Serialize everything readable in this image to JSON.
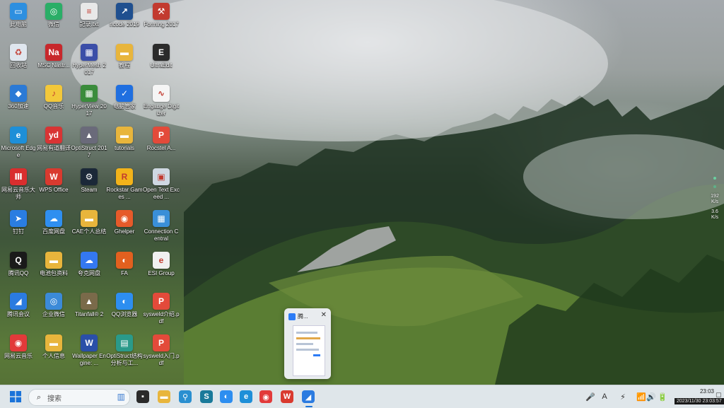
{
  "desktop": {
    "icons": [
      {
        "label": "此电脑",
        "glyph": "▭",
        "color": "#2d8fe0"
      },
      {
        "label": "微信",
        "glyph": "◎",
        "color": "#2aae67"
      },
      {
        "label": "記录.txt",
        "glyph": "≡",
        "color": "#e8e8e8"
      },
      {
        "label": "ncode 2019",
        "glyph": "↗",
        "color": "#1f4f8f"
      },
      {
        "label": "Forming 2017",
        "glyph": "⚒",
        "color": "#c23a2f"
      },
      {
        "label": "回收站",
        "glyph": "♻",
        "color": "#dfe6ee"
      },
      {
        "label": "MSC Nastr...",
        "glyph": "Na",
        "color": "#c8282c"
      },
      {
        "label": "HyperMesh 2017",
        "glyph": "▦",
        "color": "#3b4ea8"
      },
      {
        "label": "教程",
        "glyph": "▬",
        "color": "#e8b53c"
      },
      {
        "label": "UltraEdit",
        "glyph": "E",
        "color": "#2b2b2b"
      },
      {
        "label": "360加速",
        "glyph": "◆",
        "color": "#2b7ad6"
      },
      {
        "label": "QQ音乐",
        "glyph": "♪",
        "color": "#f3c83a"
      },
      {
        "label": "HyperView 2017",
        "glyph": "▦",
        "color": "#3b8c3c"
      },
      {
        "label": "电脑管家",
        "glyph": "✓",
        "color": "#1f6fe0"
      },
      {
        "label": "Engauge Digitizer",
        "glyph": "∿",
        "color": "#f5f5f5"
      },
      {
        "label": "Microsoft Edge",
        "glyph": "e",
        "color": "#1e8fd8"
      },
      {
        "label": "网易有道翻译",
        "glyph": "yd",
        "color": "#d83434"
      },
      {
        "label": "OptiStruct 2017",
        "glyph": "▲",
        "color": "#6a6a7a"
      },
      {
        "label": "tutorials",
        "glyph": "▬",
        "color": "#e8b53c"
      },
      {
        "label": "Rocstel A...",
        "glyph": "P",
        "color": "#e34a3a"
      },
      {
        "label": "网易云音乐大师",
        "glyph": "Ⅲ",
        "color": "#d92e2e"
      },
      {
        "label": "WPS Office",
        "glyph": "W",
        "color": "#d93a2f"
      },
      {
        "label": "Steam",
        "glyph": "⚙",
        "color": "#1b2838"
      },
      {
        "label": "Rockstar Games ...",
        "glyph": "R",
        "color": "#f2b31a"
      },
      {
        "label": "Open Text Exceed ...",
        "glyph": "▣",
        "color": "#cfd8e2"
      },
      {
        "label": "钉钉",
        "glyph": "➤",
        "color": "#2a7de1"
      },
      {
        "label": "百度网盘",
        "glyph": "☁",
        "color": "#2f8ff0"
      },
      {
        "label": "CAE个人总结",
        "glyph": "▬",
        "color": "#e8b53c"
      },
      {
        "label": "Ghelper",
        "glyph": "◉",
        "color": "#e65a2a"
      },
      {
        "label": "Connection Central",
        "glyph": "▦",
        "color": "#3a8fd8"
      },
      {
        "label": "腾讯QQ",
        "glyph": "Q",
        "color": "#1a1a1a"
      },
      {
        "label": "电池包资料",
        "glyph": "▬",
        "color": "#e8b53c"
      },
      {
        "label": "夸克网盘",
        "glyph": "☁",
        "color": "#3478f0"
      },
      {
        "label": "FA",
        "glyph": "◐",
        "color": "#e2601f"
      },
      {
        "label": "ESI Group",
        "glyph": "e",
        "color": "#f0f0f0"
      },
      {
        "label": "腾讯会议",
        "glyph": "◢",
        "color": "#2b7be0"
      },
      {
        "label": "企业微信",
        "glyph": "◎",
        "color": "#3b8ad8"
      },
      {
        "label": "Titanfall® 2",
        "glyph": "▲",
        "color": "#7a6a4a"
      },
      {
        "label": "QQ浏览器",
        "glyph": "◐",
        "color": "#2d8ef0"
      },
      {
        "label": "sysweld介绍.pdf",
        "glyph": "P",
        "color": "#e34a3a"
      },
      {
        "label": "网易云音乐",
        "glyph": "◉",
        "color": "#e23a3a"
      },
      {
        "label": "个人信息",
        "glyph": "▬",
        "color": "#e8b53c"
      },
      {
        "label": "Wallpaper Engine: ...",
        "glyph": "W",
        "color": "#2a4fa8"
      },
      {
        "label": "OptiStruct结构分析与工...",
        "glyph": "▤",
        "color": "#2a9a8a"
      },
      {
        "label": "sysweld入门.pdf",
        "glyph": "P",
        "color": "#e34a3a"
      }
    ]
  },
  "preview": {
    "title": "腾...",
    "close": "✕"
  },
  "widget": {
    "upload": "192",
    "upload_unit": "K/s",
    "download": "3.6",
    "download_unit": "K/s"
  },
  "taskbar": {
    "search_placeholder": "搜索",
    "apps": [
      {
        "name": "task-view-icon",
        "glyph": "▪",
        "color": "#2a2a2a"
      },
      {
        "name": "file-explorer-icon",
        "glyph": "▬",
        "color": "#e8b53c"
      },
      {
        "name": "pin-tool-icon",
        "glyph": "⚲",
        "color": "#2a8fd0"
      },
      {
        "name": "sf-app-icon",
        "glyph": "S",
        "color": "#1a7a9a"
      },
      {
        "name": "qq-browser-icon",
        "glyph": "◐",
        "color": "#2d8ef0"
      },
      {
        "name": "edge-icon",
        "glyph": "e",
        "color": "#1e8fd8"
      },
      {
        "name": "netease-music-icon",
        "glyph": "◉",
        "color": "#e23a3a"
      },
      {
        "name": "wps-icon",
        "glyph": "W",
        "color": "#d93a2f"
      },
      {
        "name": "tencent-meeting-icon",
        "glyph": "◢",
        "color": "#2b7be0"
      }
    ],
    "tray": [
      "🎤",
      "A",
      "⚡",
      "📶",
      "🔊",
      "🔋"
    ],
    "time": "23:03",
    "date": "2023/11/30"
  },
  "stamp": "2023/11/30 23:03:57"
}
